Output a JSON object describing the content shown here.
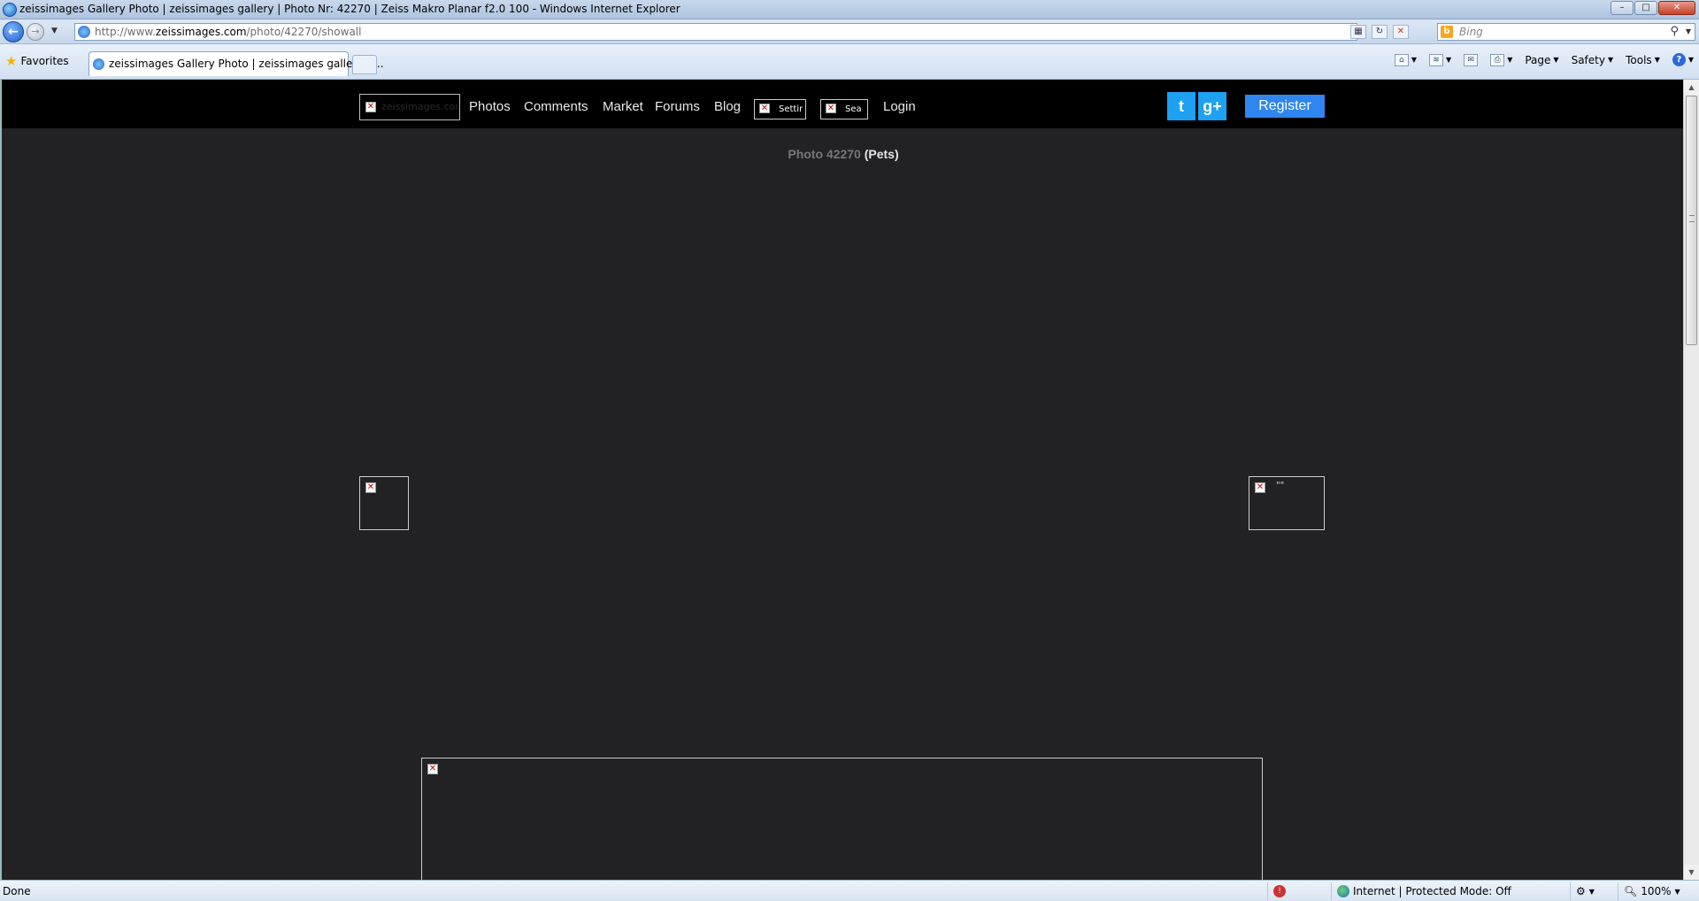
{
  "window": {
    "title": "zeissimages Gallery Photo | zeissimages gallery | Photo Nr: 42270 | Zeiss Makro Planar f2.0 100 - Windows Internet Explorer",
    "controls": {
      "minimize": "–",
      "maximize": "□",
      "close": "✕"
    }
  },
  "addressbar": {
    "url_prefix": "http://www.",
    "url_domain": "zeissimages.com",
    "url_path": "/photo/42270/showall",
    "search_placeholder": "Bing"
  },
  "favorites": {
    "label": "Favorites"
  },
  "tabs": [
    {
      "label": "zeissimages Gallery Photo | zeissimages gallery | ..."
    }
  ],
  "commandbar": {
    "page": "Page",
    "safety": "Safety",
    "tools": "Tools"
  },
  "site": {
    "logo_alt": "zeissimages.com",
    "menu": [
      "Photos",
      "Comments",
      "Market",
      "Forums",
      "Blog"
    ],
    "settings_alt": "Settir",
    "search_alt": "Sea",
    "login": "Login",
    "twitter": "t",
    "gplus": "g+",
    "register": "Register",
    "photo_number": "Photo 42270",
    "photo_category": "(Pets)",
    "next_alt": "\"\""
  },
  "statusbar": {
    "text": "Done",
    "zone": "Internet | Protected Mode: Off",
    "zoom": "100%"
  },
  "icons": [
    "ie-icon",
    "back-icon",
    "forward-icon",
    "refresh-icon",
    "stop-icon",
    "search-icon",
    "star-icon",
    "home-icon",
    "feeds-icon",
    "mail-icon",
    "print-icon",
    "help-icon",
    "broken-image-icon",
    "twitter-icon",
    "google-plus-icon",
    "globe-icon"
  ],
  "colors": {
    "site_bg": "#222224",
    "nav_bg": "#000000",
    "register": "#2f86f0",
    "twitter": "#1da1f2"
  }
}
